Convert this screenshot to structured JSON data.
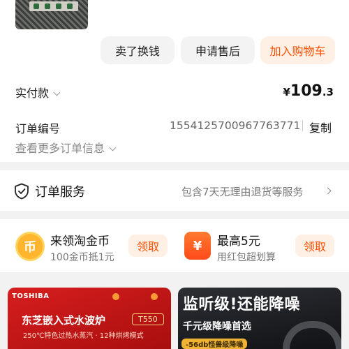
{
  "actions": {
    "sell_label": "卖了换钱",
    "after_sales_label": "申请售后",
    "add_cart_label": "加入购物车"
  },
  "payment": {
    "label": "实付款",
    "currency": "¥",
    "amount_int": "109",
    "amount_dec": ".3"
  },
  "order": {
    "number_label": "订单编号",
    "number_value": "1554125700967763771",
    "copy_label": "复制",
    "more_info_label": "查看更多订单信息"
  },
  "service": {
    "title": "订单服务",
    "description": "包含7天无理由退货等服务"
  },
  "coins": {
    "title": "来领淘金币",
    "subtitle": "100金币抵1元",
    "claim_label": "领取",
    "icon_glyph": "币"
  },
  "redpacket": {
    "title": "最高5元",
    "subtitle": "用红包超划算",
    "claim_label": "领取",
    "icon_glyph": "¥"
  },
  "ads": {
    "left": {
      "brand": "TOSHIBA",
      "product": "东芝嵌入式水波炉",
      "model": "T550",
      "features": "250℃特色过热水蒸汽 · 12种烘烤模式"
    },
    "right": {
      "headline": "监听级!还能降噪",
      "subline": "千元级降噪首选",
      "tag": "-56db怪兽级降噪"
    }
  },
  "colors": {
    "accent": "#ff5000",
    "accent_bg": "#fff0e6",
    "muted_text": "#777777",
    "page_bg": "#f2f2f2"
  }
}
